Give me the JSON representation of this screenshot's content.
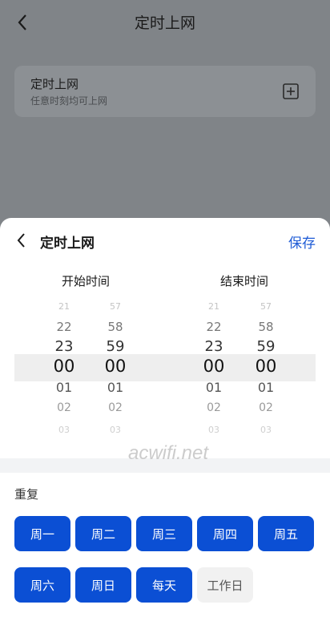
{
  "header": {
    "title": "定时上网"
  },
  "background_card": {
    "title": "定时上网",
    "subtitle": "任意时刻均可上网"
  },
  "sheet": {
    "title": "定时上网",
    "save_label": "保存",
    "start_label": "开始时间",
    "end_label": "结束时间",
    "start_hours": [
      "21",
      "22",
      "23",
      "00",
      "01",
      "02",
      "03"
    ],
    "start_minutes": [
      "57",
      "58",
      "59",
      "00",
      "01",
      "02",
      "03"
    ],
    "end_hours": [
      "21",
      "22",
      "23",
      "00",
      "01",
      "02",
      "03"
    ],
    "end_minutes": [
      "57",
      "58",
      "59",
      "00",
      "01",
      "02",
      "03"
    ]
  },
  "repeat": {
    "label": "重复",
    "days": [
      {
        "label": "周一",
        "selected": true
      },
      {
        "label": "周二",
        "selected": true
      },
      {
        "label": "周三",
        "selected": true
      },
      {
        "label": "周四",
        "selected": true
      },
      {
        "label": "周五",
        "selected": true
      },
      {
        "label": "周六",
        "selected": true
      },
      {
        "label": "周日",
        "selected": true
      },
      {
        "label": "每天",
        "selected": true
      },
      {
        "label": "工作日",
        "selected": false
      }
    ]
  },
  "watermark": "acwifi.net",
  "colors": {
    "accent": "#0b4fd4",
    "link": "#1e5bd6"
  }
}
